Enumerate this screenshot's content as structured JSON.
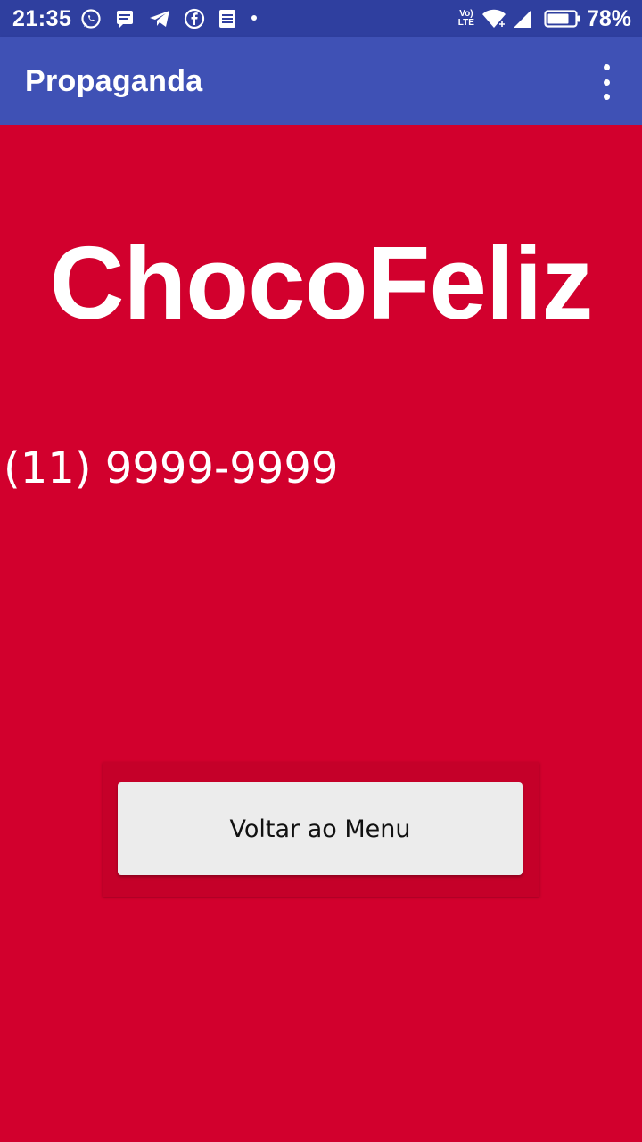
{
  "status_bar": {
    "time": "21:35",
    "notification_icons": [
      "whatsapp-icon",
      "message-icon",
      "telegram-icon",
      "facebook-icon",
      "note-icon",
      "dot-icon"
    ],
    "volte_top": "Vo)",
    "volte_bottom": "LTE",
    "battery_percent": "78%"
  },
  "app_bar": {
    "title": "Propaganda",
    "overflow_icon": "more-vert-icon"
  },
  "main": {
    "brand": "ChocoFeliz",
    "phone": "(11) 9999-9999",
    "back_button_label": "Voltar ao Menu"
  },
  "colors": {
    "status_bar": "#2f3f9f",
    "app_bar": "#3f51b5",
    "background": "#d2002d",
    "button": "#ececec"
  }
}
